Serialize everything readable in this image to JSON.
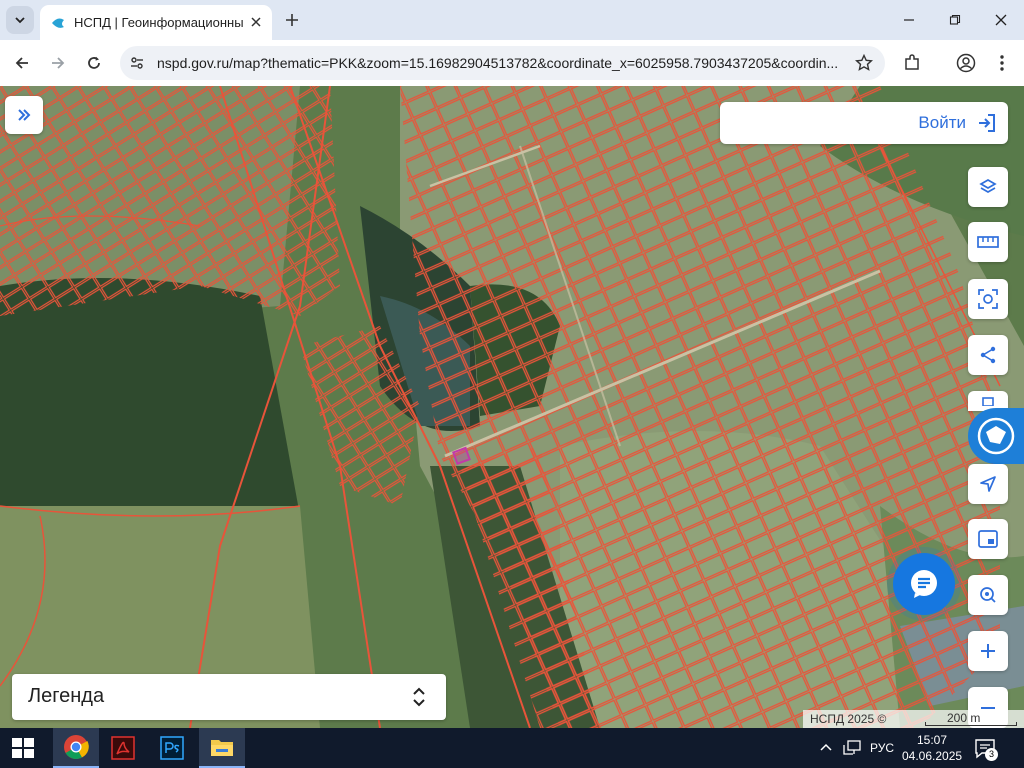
{
  "browser": {
    "tab_title": "НСПД | Геоинформационный",
    "url": "nspd.gov.ru/map?thematic=PKK&zoom=15.16982904513782&coordinate_x=6025958.7903437205&coordin..."
  },
  "map": {
    "login_label": "Войти",
    "legend_label": "Легенда",
    "attribution": "НСПД 2025 ©",
    "scale_label": "200 m",
    "parcel_outline_color": "#e8543a",
    "selected_parcel_color": "#c23aa8",
    "tools": [
      "layers-icon",
      "ruler-icon",
      "area-select-icon",
      "share-icon",
      "print-icon",
      "navigate-icon",
      "frame-icon",
      "location-search-icon",
      "zoom-in-icon",
      "zoom-out-icon"
    ]
  },
  "taskbar": {
    "apps": [
      "chrome-icon",
      "acrobat-icon",
      "photoshop-icon",
      "file-explorer-icon"
    ],
    "language": "РУС",
    "time": "15:07",
    "date": "04.06.2025",
    "notification_count": "3"
  }
}
